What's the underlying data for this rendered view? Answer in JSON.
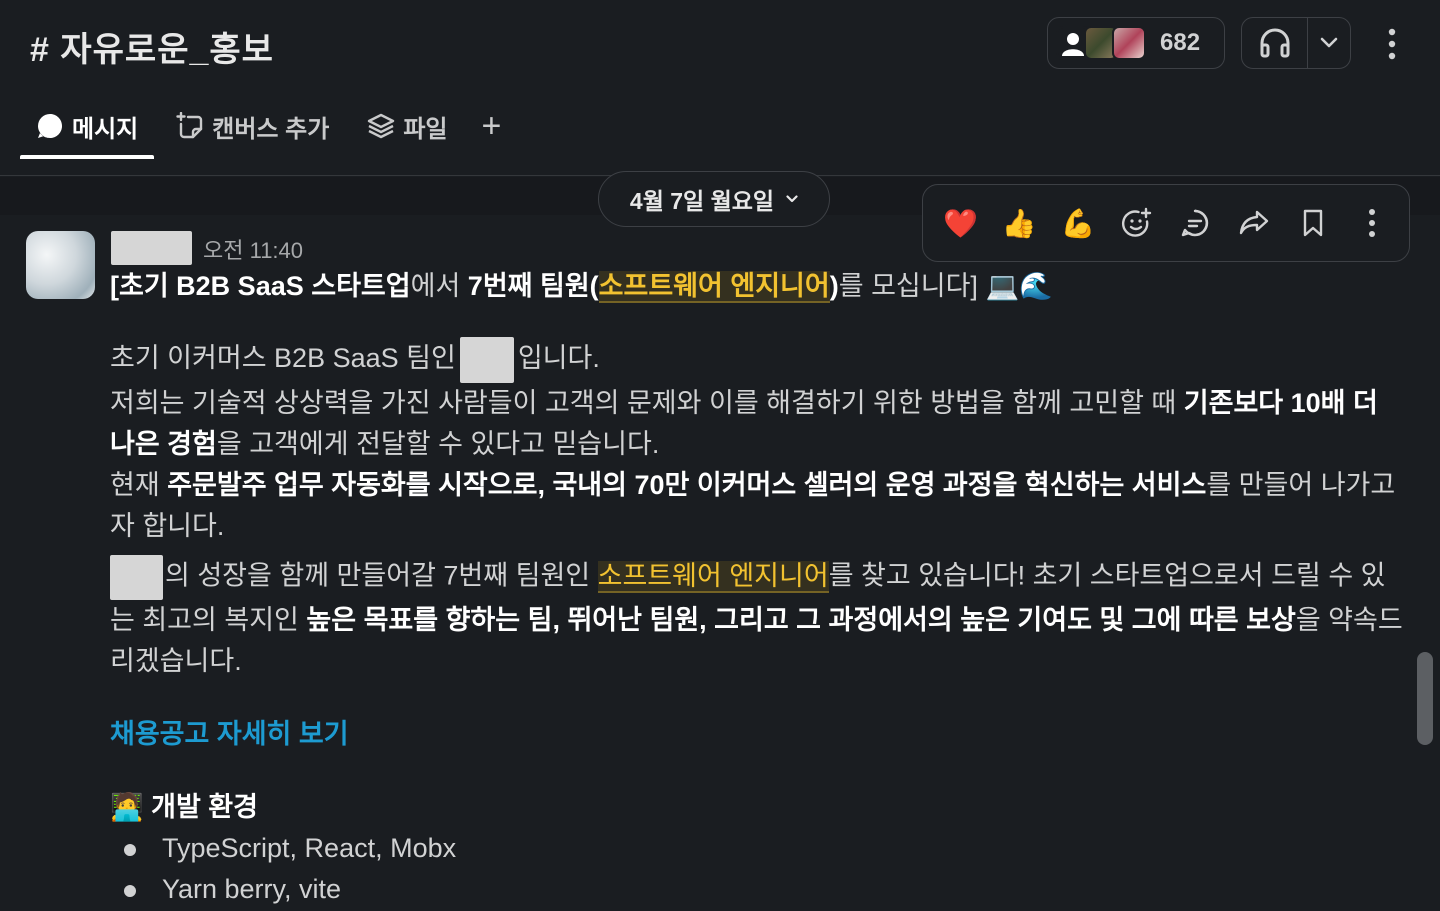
{
  "header": {
    "channel_title": "# 자유로운_홍보",
    "member_count": "682"
  },
  "tabs": [
    {
      "label": "메시지",
      "icon": "message-icon",
      "active": true
    },
    {
      "label": "캔버스 추가",
      "icon": "canvas-icon",
      "active": false
    },
    {
      "label": "파일",
      "icon": "layers-icon",
      "active": false
    }
  ],
  "add_tab_label": "+",
  "date_divider": "4월 7일 월요일",
  "message_actions": {
    "reactions": [
      "❤️",
      "👍",
      "💪"
    ],
    "icons": [
      "add-reaction-icon",
      "reply-thread-icon",
      "forward-icon",
      "bookmark-icon",
      "more-actions-icon"
    ]
  },
  "message": {
    "timestamp": "오전 11:40",
    "title_prefix": "[초기 B2B SaaS 스타트업",
    "title_mid1": "에서 ",
    "title_bold2": "7번째 팀원(",
    "title_highlight": "소프트웨어 엔지니어",
    "title_bold3": ")",
    "title_suffix": "를 모십니다] 💻🌊",
    "p1_a": "초기 이커머스 B2B SaaS 팀인",
    "p1_b": "입니다.",
    "p2_a": "저희는 기술적 상상력을 가진 사람들이 고객의 문제와 이를 해결하기 위한 방법을 함께 고민할 때 ",
    "p2_bold": "기존보다 10배 더 나은 경험",
    "p2_b": "을 고객에게 전달할 수 있다고 믿습니다.",
    "p3_a": "현재 ",
    "p3_bold": "주문발주 업무 자동화를 시작으로, 국내의 70만 이커머스 셀러의 운영 과정을 혁신하는 서비스",
    "p3_b": "를 만들어 나가고자 합니다.",
    "p4_a": "의 성장을 함께 만들어갈 7번째 팀원인 ",
    "p4_highlight": "소프트웨어 엔지니어",
    "p4_b": "를 찾고 있습니다! 초기 스타트업으로서 드릴 수 있는 최고의 복지인 ",
    "p4_bold": "높은 목표를 향하는 팀, 뛰어난 팀원, 그리고 그 과정에서의 높은 기여도 및 그에 따른 보상",
    "p4_c": "을 약속드리겠습니다.",
    "link_text": "채용공고 자세히 보기",
    "section_title": "🧑‍💻 개발 환경",
    "bullets": [
      "TypeScript, React, Mobx",
      "Yarn berry, vite"
    ]
  }
}
